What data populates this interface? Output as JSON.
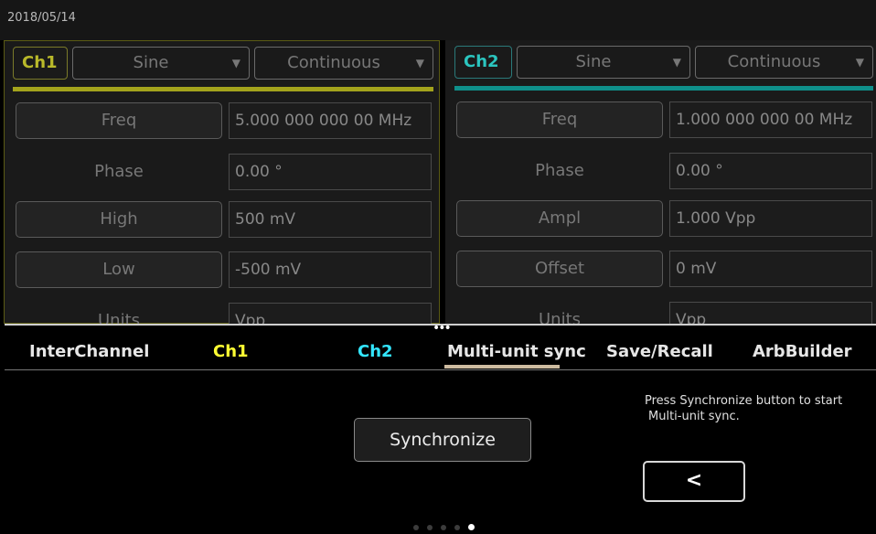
{
  "status": {
    "date": "2018/05/14"
  },
  "ch1": {
    "label": "Ch1",
    "color": "#b9b92a",
    "waveform": "Sine",
    "mode": "Continuous",
    "params": [
      {
        "label": "Freq",
        "value": "5.000 000 000 00 MHz"
      },
      {
        "label": "Phase",
        "value": "0.00 °"
      },
      {
        "label": "High",
        "value": "500 mV"
      },
      {
        "label": "Low",
        "value": "-500 mV"
      },
      {
        "label": "Units",
        "value": "Vpp"
      }
    ]
  },
  "ch2": {
    "label": "Ch2",
    "color": "#1aa39f",
    "waveform": "Sine",
    "mode": "Continuous",
    "params": [
      {
        "label": "Freq",
        "value": "1.000 000 000 00 MHz"
      },
      {
        "label": "Phase",
        "value": "0.00 °"
      },
      {
        "label": "Ampl",
        "value": "1.000 Vpp"
      },
      {
        "label": "Offset",
        "value": "0 mV"
      },
      {
        "label": "Units",
        "value": "Vpp"
      }
    ]
  },
  "icons": {
    "dropdown": "caret-down-icon",
    "more": "more-dots-icon",
    "back": "chevron-left-icon"
  },
  "glyphs": {
    "dropdown": "▼",
    "more": "•••",
    "back": "<"
  },
  "tabs": {
    "items": [
      {
        "label": "InterChannel",
        "color": "#e6e6e6"
      },
      {
        "label": "Ch1",
        "color": "#ffff33"
      },
      {
        "label": "Ch2",
        "color": "#33e6ff"
      },
      {
        "label": "Multi-unit sync",
        "color": "#e6e6e6"
      },
      {
        "label": "Save/Recall",
        "color": "#e6e6e6"
      },
      {
        "label": "ArbBuilder",
        "color": "#e6e6e6"
      }
    ],
    "active": "Multi-unit sync"
  },
  "sync": {
    "button_label": "Synchronize",
    "message_line1": "Press Synchronize button to start",
    "message_line2": "Multi-unit sync."
  },
  "pager": {
    "total": 5,
    "current": 5
  }
}
